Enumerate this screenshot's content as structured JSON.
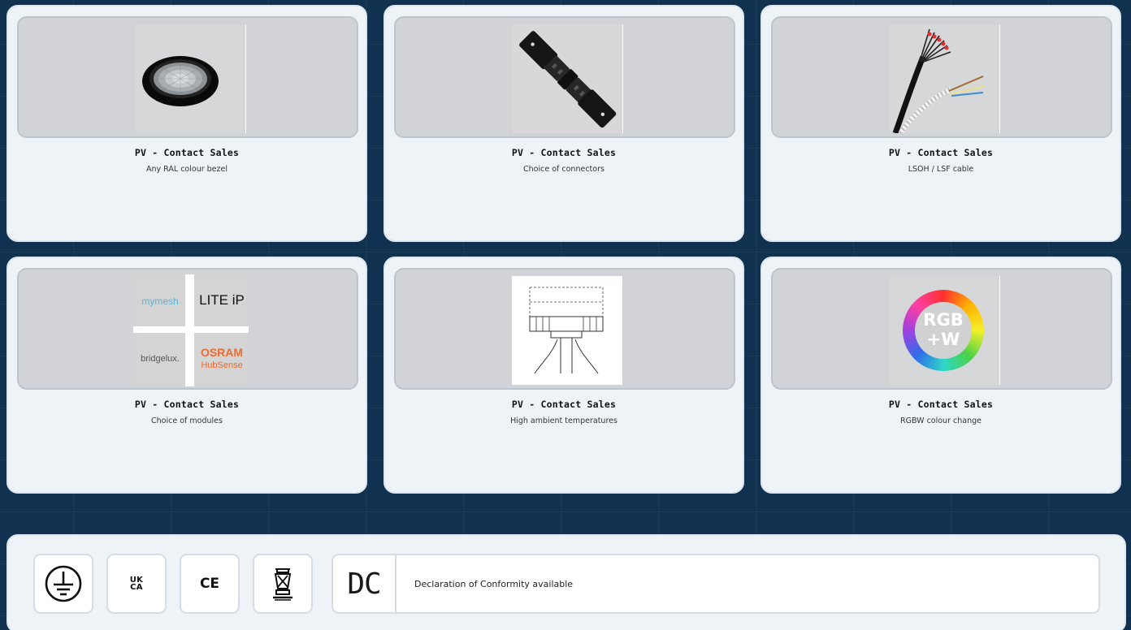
{
  "cards": [
    {
      "title": "PV - Contact Sales",
      "desc": "Any RAL colour bezel",
      "image": "recessed-downlight-bezel"
    },
    {
      "title": "PV - Contact Sales",
      "desc": "Choice of connectors",
      "image": "black-connector-plug"
    },
    {
      "title": "PV - Contact Sales",
      "desc": "LSOH / LSF cable",
      "image": "multicore-cable"
    },
    {
      "title": "PV - Contact Sales",
      "desc": "Choice of modules",
      "image": "module-brand-logos",
      "logos": {
        "mymesh": "mymesh",
        "liteip": "LITE iP",
        "bridgelux": "bridgelux.",
        "osram": "OSRAM",
        "hubsense": "HubSense"
      }
    },
    {
      "title": "PV - Contact Sales",
      "desc": "High ambient temperatures",
      "image": "heat-diagram"
    },
    {
      "title": "PV - Contact Sales",
      "desc": "RGBW colour change",
      "image": "rgbw-colour-wheel",
      "badge": [
        "RGB",
        "+W"
      ]
    }
  ],
  "certifications": {
    "icons": [
      "earth-ground-icon",
      "ukca-mark",
      "ce-mark",
      "lamp-safety-icon"
    ],
    "ukca": "UK\nCA",
    "ce": "CE",
    "doc_mark": "DC",
    "doc_text": "Declaration of Conformity available"
  },
  "colors": {
    "background": "#10314f",
    "card": "#eef3f8",
    "image_box": "#d1d3d6",
    "osram": "#ee6a2e",
    "mymesh": "#5ab3db"
  }
}
